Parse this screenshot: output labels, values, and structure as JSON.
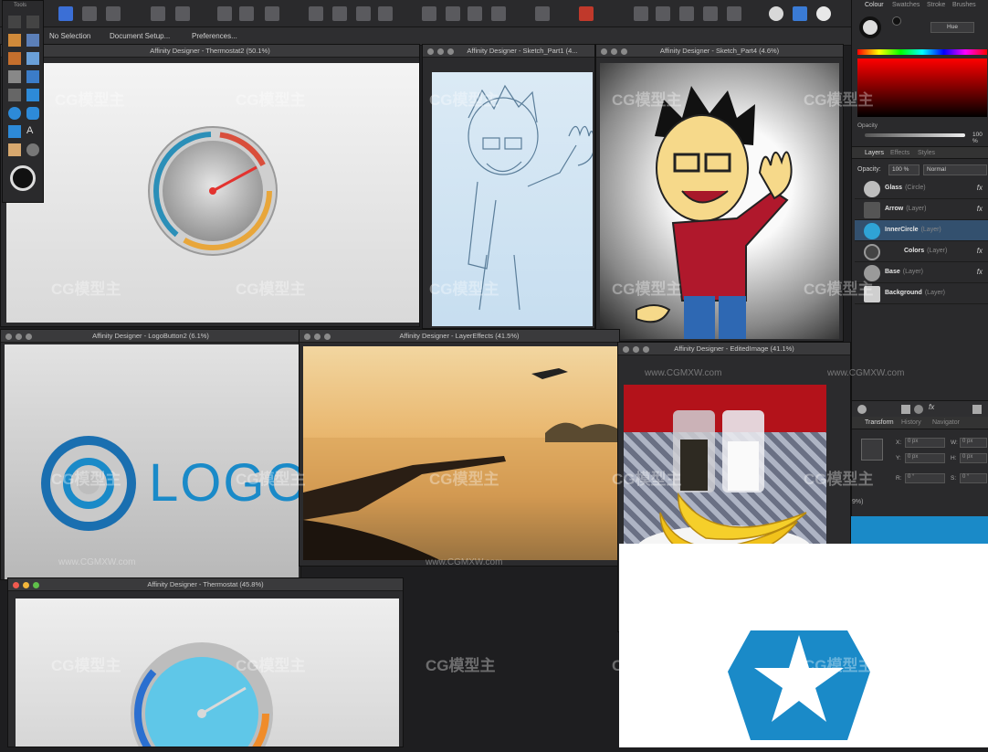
{
  "tools_label": "Tools",
  "context_bar": {
    "no_selection": "No Selection",
    "document_setup": "Document Setup...",
    "preferences": "Preferences..."
  },
  "windows": {
    "thermostat2": "Affinity Designer - Thermostat2 (50.1%)",
    "sketch_part1": "Affinity Designer - Sketch_Part1 (4...",
    "sketch_part4": "Affinity Designer - Sketch_Part4 (4.6%)",
    "logobutton2": "Affinity Designer - LogoButton2 (6.1%)",
    "layereffects": "Affinity Designer - LayerEffects (41.5%)",
    "editedimage": "Affinity Designer - EditedImage (41.1%)",
    "thermostat": "Affinity Designer - Thermostat (45.8%)"
  },
  "logo_text": "LOGO",
  "panel": {
    "tabs": [
      "Colour",
      "Swatches",
      "Stroke",
      "Brushes"
    ],
    "hue_label": "Hue",
    "opacity_label": "Opacity",
    "opacity_value": "100 %",
    "layer_tabs": [
      "Layers",
      "Effects",
      "Styles"
    ],
    "layers_opacity_label": "Opacity:",
    "layers_opacity_value": "100 %",
    "blend_mode": "Normal",
    "layers": [
      {
        "name": "Glass",
        "kind": "(Circle)",
        "fx": "fx",
        "color": "#bdbdbd"
      },
      {
        "name": "Arrow",
        "kind": "(Layer)",
        "fx": "fx",
        "color": "#555555"
      },
      {
        "name": "InnerCircle",
        "kind": "(Layer)",
        "fx": "",
        "color": "#2fa3d6"
      },
      {
        "name": "Colors",
        "kind": "(Layer)",
        "fx": "fx",
        "color": "#444444"
      },
      {
        "name": "Base",
        "kind": "(Layer)",
        "fx": "fx",
        "color": "#9a9a9a"
      },
      {
        "name": "Background",
        "kind": "(Layer)",
        "fx": "",
        "color": "#cfcfcf"
      }
    ],
    "bottom_tabs": [
      "Transform",
      "History",
      "Navigator"
    ],
    "transform": {
      "x_label": "X:",
      "x_val": "0 px",
      "y_label": "Y:",
      "y_val": "0 px",
      "w_label": "W:",
      "w_val": "0 px",
      "h_label": "H:",
      "h_val": "0 px",
      "r_label": "R:",
      "r_val": "0 °",
      "s_label": "S:",
      "s_val": "0 °"
    },
    "zoom": "9%)"
  },
  "watermark": "CG模型主",
  "watermark_url": "www.CGMXW.com",
  "colors": {
    "accent_blue": "#1a8ac8",
    "thermo_red": "#e3332f"
  }
}
